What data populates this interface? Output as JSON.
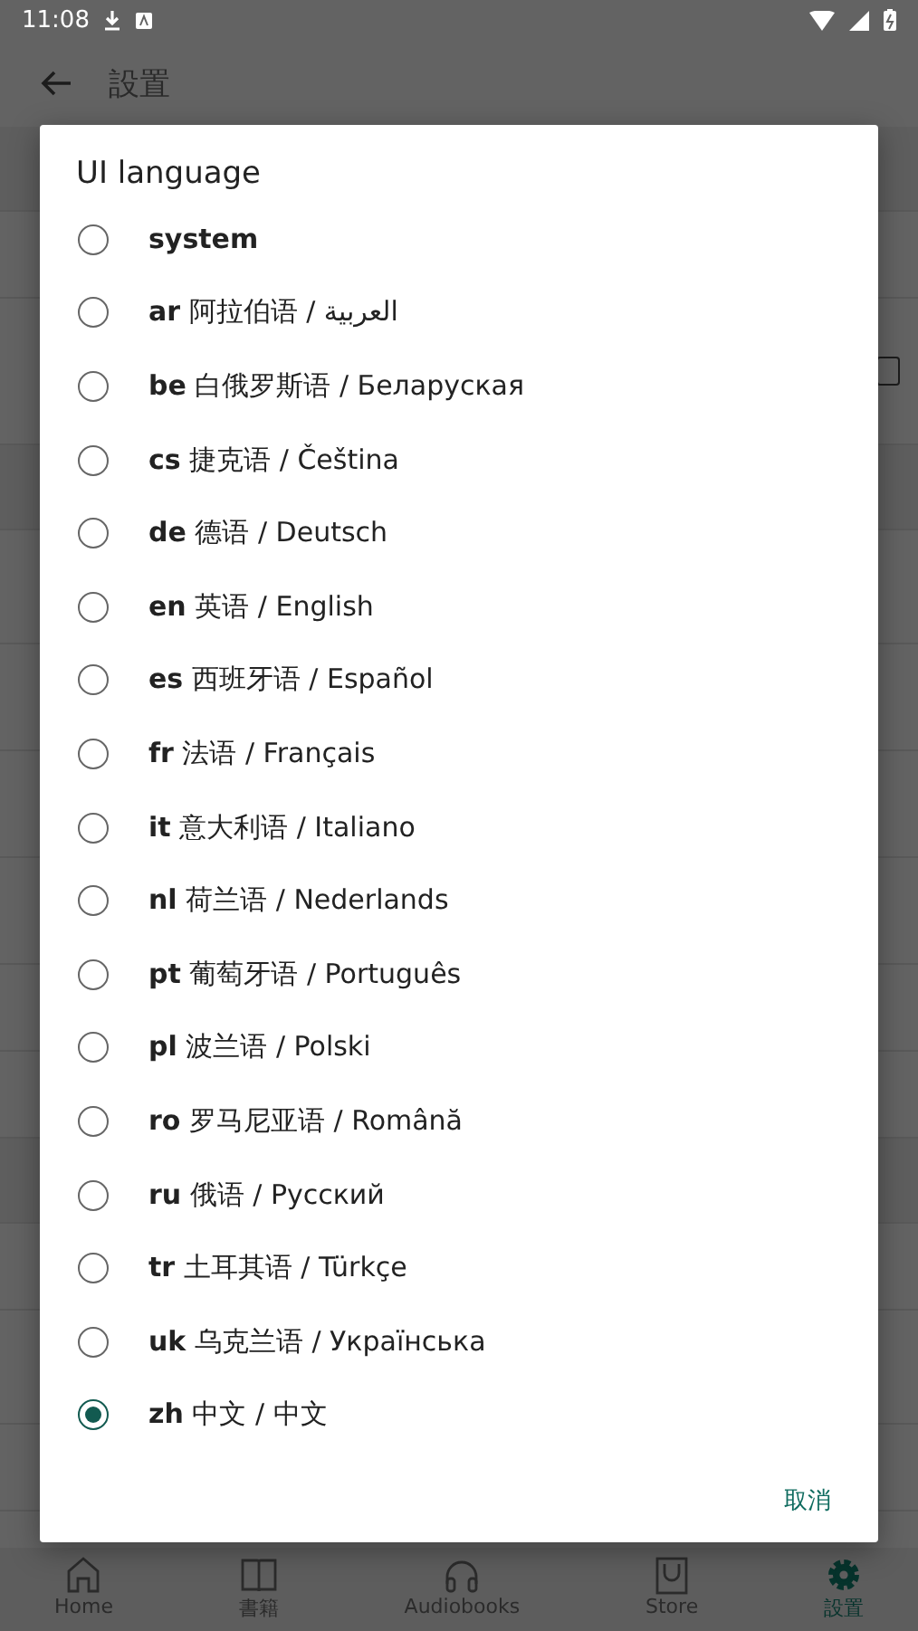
{
  "status_bar": {
    "time": "11:08"
  },
  "app_bar": {
    "title": "設置"
  },
  "settings": [
    {
      "kind": "header"
    },
    {
      "kind": "item"
    },
    {
      "kind": "toggle",
      "checked": false
    },
    {
      "kind": "header"
    },
    {
      "kind": "item"
    },
    {
      "kind": "item"
    },
    {
      "kind": "item"
    },
    {
      "kind": "item"
    },
    {
      "kind": "item"
    },
    {
      "kind": "item"
    },
    {
      "kind": "header"
    },
    {
      "kind": "item"
    },
    {
      "kind": "item"
    },
    {
      "kind": "item"
    }
  ],
  "dialog": {
    "title": "UI language",
    "options": [
      {
        "code": "system",
        "selected": false
      },
      {
        "code": "ar",
        "name": "阿拉伯语 / العربية",
        "selected": false
      },
      {
        "code": "be",
        "name": "白俄罗斯语 / Беларуская",
        "selected": false
      },
      {
        "code": "cs",
        "name": "捷克语 / Čeština",
        "selected": false
      },
      {
        "code": "de",
        "name": "德语 / Deutsch",
        "selected": false
      },
      {
        "code": "en",
        "name": "英语 / English",
        "selected": false
      },
      {
        "code": "es",
        "name": "西班牙语 / Español",
        "selected": false
      },
      {
        "code": "fr",
        "name": "法语 / Français",
        "selected": false
      },
      {
        "code": "it",
        "name": "意大利语 / Italiano",
        "selected": false
      },
      {
        "code": "nl",
        "name": "荷兰语 / Nederlands",
        "selected": false
      },
      {
        "code": "pt",
        "name": "葡萄牙语 / Português",
        "selected": false
      },
      {
        "code": "pl",
        "name": "波兰语 / Polski",
        "selected": false
      },
      {
        "code": "ro",
        "name": "罗马尼亚语 / Română",
        "selected": false
      },
      {
        "code": "ru",
        "name": "俄语 / Русский",
        "selected": false
      },
      {
        "code": "tr",
        "name": "土耳其语 / Türkçe",
        "selected": false
      },
      {
        "code": "uk",
        "name": "乌克兰语 / Українська",
        "selected": false
      },
      {
        "code": "zh",
        "name": "中文 / 中文",
        "selected": true
      }
    ],
    "cancel": "取消"
  },
  "bottom_nav": [
    {
      "kind": "home",
      "label": "Home",
      "selected": false
    },
    {
      "kind": "book",
      "label": "書籍",
      "selected": false
    },
    {
      "kind": "headphones",
      "label": "Audiobooks",
      "selected": false
    },
    {
      "kind": "bag",
      "label": "Store",
      "selected": false
    },
    {
      "kind": "gear",
      "label": "設置",
      "selected": true
    }
  ]
}
